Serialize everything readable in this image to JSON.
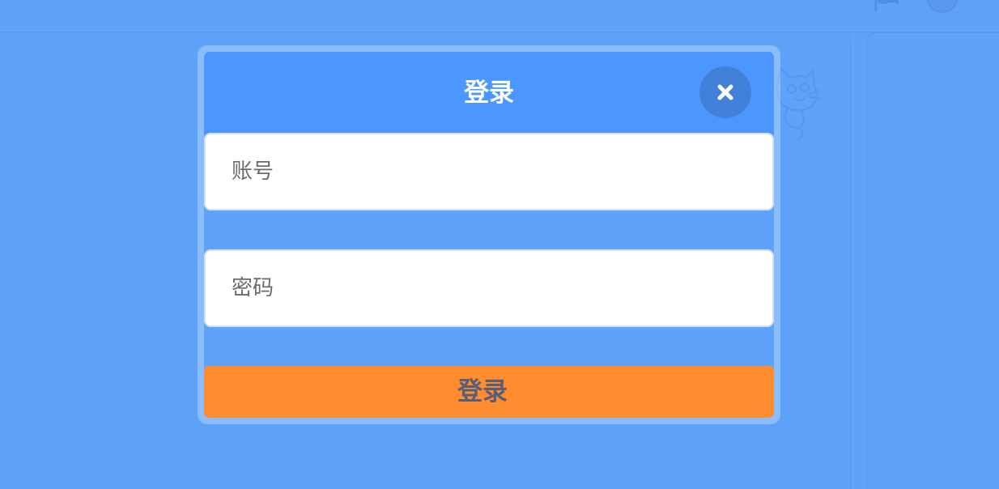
{
  "background": {
    "icons": [
      "green-flag-icon",
      "stop-icon",
      "sprite-cat-icon"
    ]
  },
  "modal": {
    "title": "登录",
    "close_icon": "close-icon",
    "account_field": {
      "placeholder": "账号",
      "value": ""
    },
    "password_field": {
      "placeholder": "密码",
      "value": ""
    },
    "submit_label": "登录"
  },
  "colors": {
    "backdrop": "#5fa2fa",
    "header": "#4c97ff",
    "submit": "#ff8c2e",
    "submit_text": "#575e75",
    "field_border": "#d6dfeb"
  }
}
